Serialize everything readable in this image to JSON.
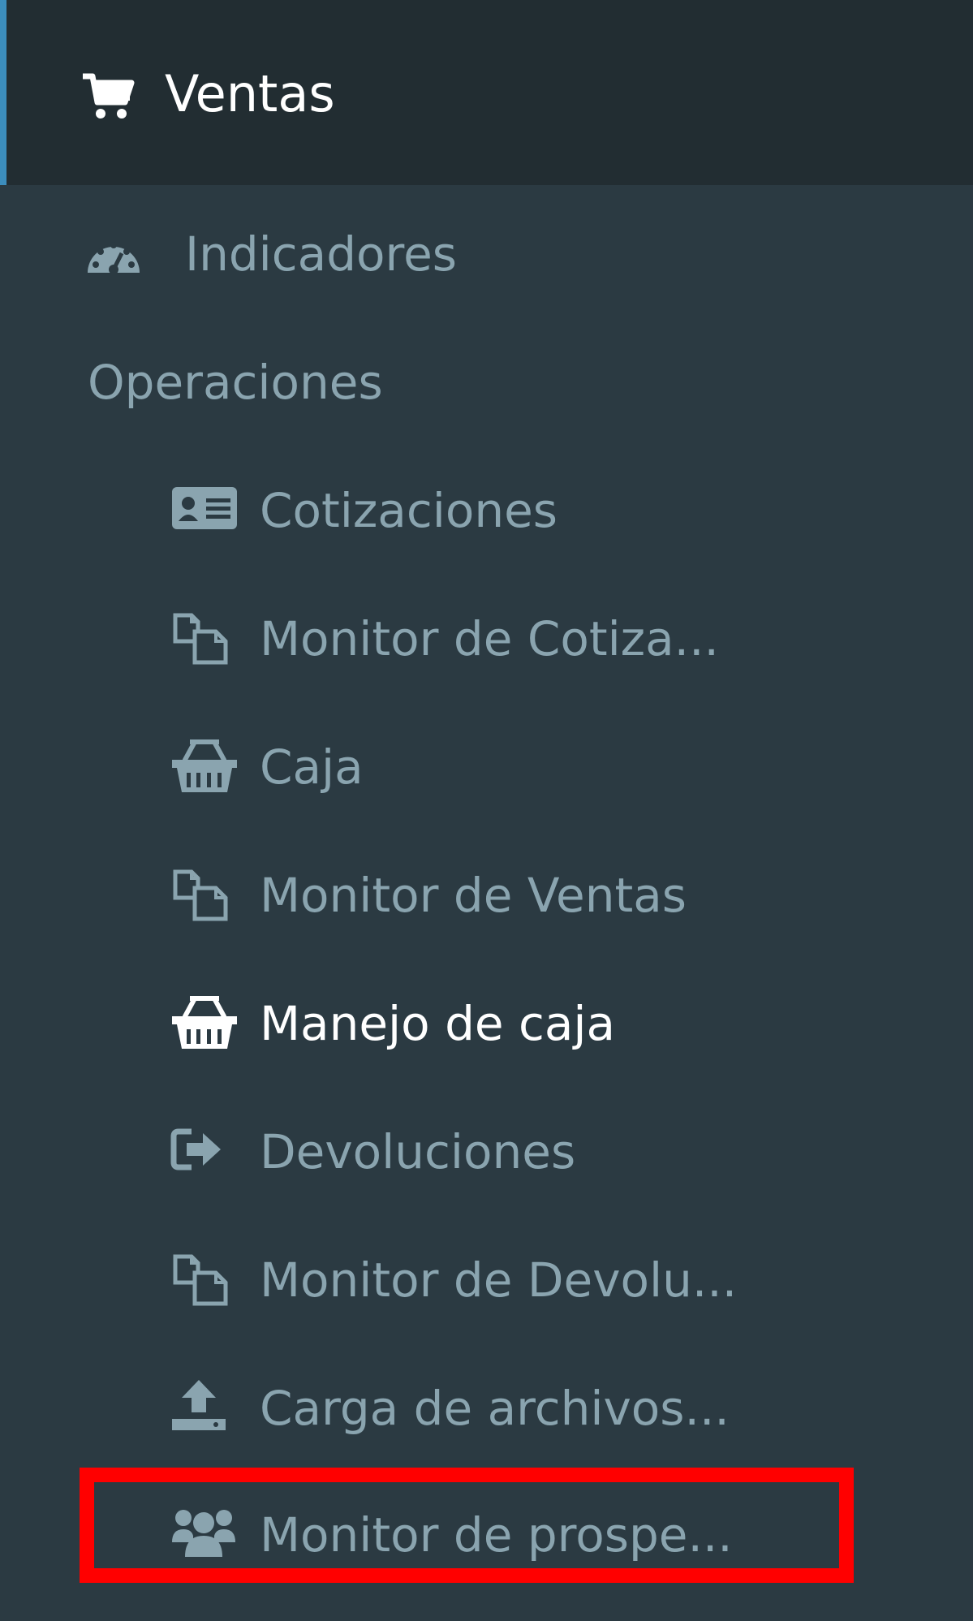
{
  "header": {
    "label": "Ventas",
    "icon": "shopping-cart-icon"
  },
  "dashboard": {
    "label": "Indicadores",
    "icon": "dashboard-icon"
  },
  "section": {
    "label": "Operaciones"
  },
  "items": [
    {
      "label": "Cotizaciones",
      "icon": "id-card-icon"
    },
    {
      "label": "Monitor de Cotiza...",
      "icon": "copy-icon"
    },
    {
      "label": "Caja",
      "icon": "basket-icon"
    },
    {
      "label": "Monitor de Ventas",
      "icon": "copy-icon"
    },
    {
      "label": "Manejo de caja",
      "icon": "basket-icon",
      "active": true
    },
    {
      "label": "Devoluciones",
      "icon": "sign-out-icon"
    },
    {
      "label": "Monitor de Devolu...",
      "icon": "copy-icon"
    },
    {
      "label": "Carga de archivos...",
      "icon": "upload-icon"
    },
    {
      "label": "Monitor de prospe...",
      "icon": "users-icon",
      "highlighted": true
    }
  ],
  "colors": {
    "header_bg": "#222d32",
    "sidebar_bg": "#2b3a42",
    "accent": "#3c8dbc",
    "text_muted": "#8aa4af",
    "text_active": "#ffffff",
    "highlight": "#ff0000"
  }
}
